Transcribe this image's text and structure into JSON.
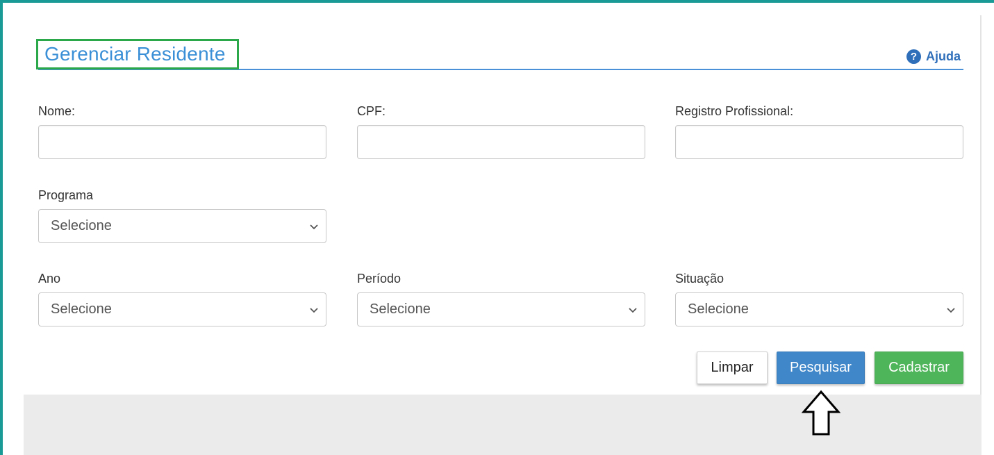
{
  "header": {
    "title": "Gerenciar Residente",
    "help_label": "Ajuda",
    "help_icon": "question-circle-icon"
  },
  "fields": {
    "nome": {
      "label": "Nome:",
      "value": ""
    },
    "cpf": {
      "label": "CPF:",
      "value": ""
    },
    "registro": {
      "label": "Registro Profissional:",
      "value": ""
    },
    "programa": {
      "label": "Programa",
      "selected": "Selecione"
    },
    "ano": {
      "label": "Ano",
      "selected": "Selecione"
    },
    "periodo": {
      "label": "Período",
      "selected": "Selecione"
    },
    "situacao": {
      "label": "Situação",
      "selected": "Selecione"
    }
  },
  "actions": {
    "limpar": "Limpar",
    "pesquisar": "Pesquisar",
    "cadastrar": "Cadastrar"
  },
  "colors": {
    "frame": "#1a9a96",
    "title": "#3a8fd6",
    "title_highlight": "#2aa84a",
    "pesquisar": "#3f87c9",
    "cadastrar": "#4fb55a"
  }
}
